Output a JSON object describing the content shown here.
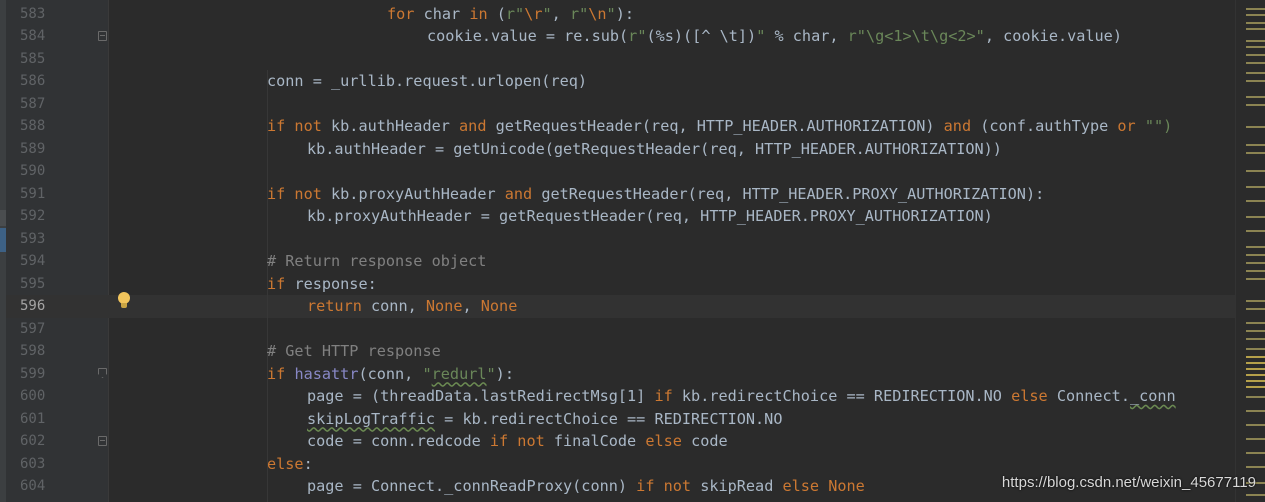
{
  "editor": {
    "current_line": "596",
    "line_numbers": [
      "583",
      "584",
      "585",
      "586",
      "587",
      "588",
      "589",
      "590",
      "591",
      "592",
      "593",
      "594",
      "595",
      "596",
      "597",
      "598",
      "599",
      "600",
      "601",
      "602",
      "603",
      "604"
    ],
    "watermark": "https://blog.csdn.net/weixin_45677119",
    "colors": {
      "background": "#2b2b2b",
      "gutter": "#313335",
      "keyword": "#cc7832",
      "string": "#6a8759",
      "comment": "#808080",
      "builtin": "#8888c6",
      "text": "#a9b7c6"
    },
    "icons": {
      "intention": "lightbulb-icon",
      "fold": "fold-marker-icon"
    }
  },
  "code": {
    "l583": {
      "kw1": "for",
      "t1": " char ",
      "kw2": "in",
      "t2": " (",
      "p1": "r\"",
      "e1": "\\r",
      "p2": "\"",
      "t3": ", ",
      "p3": "r\"",
      "e2": "\\n",
      "p4": "\"",
      "t4": "):"
    },
    "l584": {
      "t1": "cookie.value = re.sub(",
      "s1": "r\"",
      "e1": "(%s)([^ \\t])",
      "s2": "\"",
      "t2": " % char, ",
      "s3": "r\"\\g<1>\\t\\g<2>\"",
      "t3": ", cookie.value)"
    },
    "l586": {
      "t1": "conn = _urllib.request.urlopen(req)"
    },
    "l588": {
      "kw1": "if not",
      "t1": " kb.authHeader ",
      "kw2": "and",
      "t2": " getRequestHeader(req, HTTP_HEADER.AUTHORIZATION) ",
      "kw3": "and",
      "t3": " (conf.authType ",
      "kw4": "or",
      "t4": " ",
      "s1": "\"\")"
    },
    "l589": {
      "t1": "kb.authHeader = getUnicode(getRequestHeader(req, HTTP_HEADER.AUTHORIZATION))"
    },
    "l591": {
      "kw1": "if not",
      "t1": " kb.proxyAuthHeader ",
      "kw2": "and",
      "t2": " getRequestHeader(req, HTTP_HEADER.PROXY_AUTHORIZATION):"
    },
    "l592": {
      "t1": "kb.proxyAuthHeader = getRequestHeader(req, HTTP_HEADER.PROXY_AUTHORIZATION)"
    },
    "l594": {
      "c1": "# Return response object"
    },
    "l595": {
      "kw1": "if",
      "t1": " response:"
    },
    "l596": {
      "kw1": "return",
      "t1": " conn, ",
      "kw2": "None",
      "t2": ", ",
      "kw3": "None"
    },
    "l598": {
      "c1": "# Get HTTP response"
    },
    "l599": {
      "kw1": "if",
      "t1": " ",
      "b1": "hasattr",
      "t2": "(conn, ",
      "s1": "\"",
      "s2": "redurl",
      "s3": "\"",
      "t3": "):"
    },
    "l600": {
      "t1": "page = (threadData.lastRedirectMsg[1] ",
      "kw1": "if",
      "t2": " kb.redirectChoice == REDIRECTION.NO ",
      "kw2": "else",
      "t3": " Connect.",
      "t4": "_conn"
    },
    "l601": {
      "t1": "skipLogTraffic",
      "t2": " = kb.redirectChoice == REDIRECTION.NO"
    },
    "l602": {
      "t1": "code = conn.redcode ",
      "kw1": "if not",
      "t2": " finalCode ",
      "kw2": "else",
      "t3": " code"
    },
    "l603": {
      "kw1": "else",
      "t1": ":"
    },
    "l604": {
      "t1": "page = Connect._connReadProxy(conn) ",
      "kw1": "if not",
      "t2": " skipRead ",
      "kw2": "else",
      "t3": " ",
      "kw3": "None"
    }
  }
}
